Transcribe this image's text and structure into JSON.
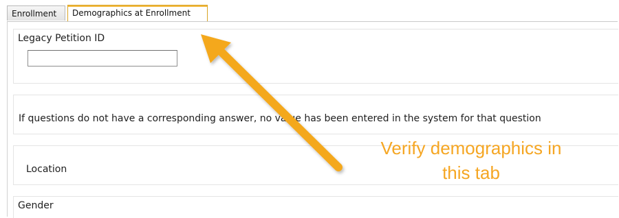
{
  "tabs": [
    {
      "label": "Enrollment",
      "active": false
    },
    {
      "label": "Demographics at Enrollment",
      "active": true
    }
  ],
  "legacy_petition": {
    "label": "Legacy Petition ID",
    "value": ""
  },
  "note": {
    "text": "If questions do not have a corresponding answer, no value has been entered in the system for that question"
  },
  "location": {
    "label": "Location"
  },
  "gender": {
    "label": "Gender"
  },
  "annotation": {
    "line1": "Verify demographics in",
    "line2": "this tab",
    "color": "#f5a623"
  },
  "colors": {
    "active_tab_border": "#d8a324",
    "section_border": "#e4e4e4"
  }
}
